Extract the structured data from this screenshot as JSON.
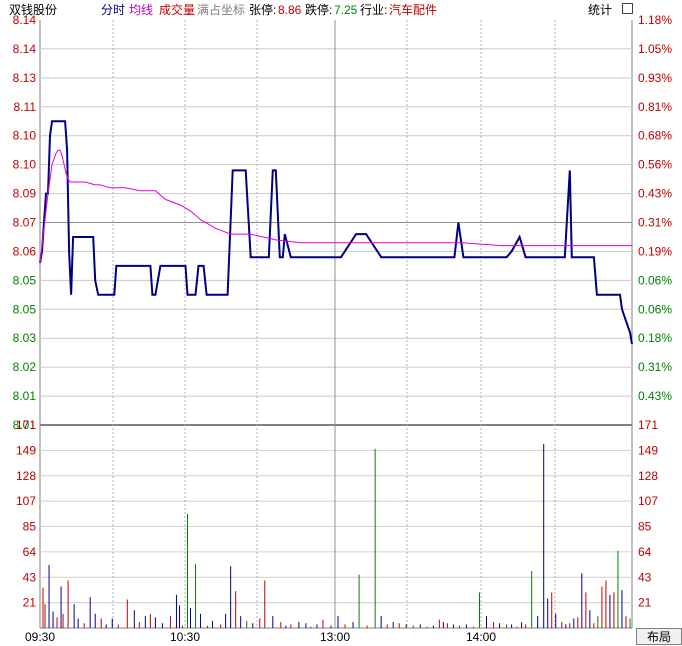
{
  "header": {
    "stock_name": "双钱股份",
    "tab_intraday": "分时",
    "tab_avg": "均线",
    "tab_volume": "成交量",
    "full_coord": "满占坐标",
    "limit_up_label": "张停:",
    "limit_up_value": "8.86",
    "limit_down_label": "跌停:",
    "limit_down_value": "7.25",
    "industry_label": "行业:",
    "industry_value": "汽车配件",
    "stats_label": "统计"
  },
  "layout_button": "布局",
  "colors": {
    "price_line": "#000080",
    "avg_line": "#e000e0",
    "up_text": "#c00000",
    "down_text": "#008000",
    "axis": "#808080",
    "blue": "#000080",
    "magenta": "#c000c0",
    "red": "#c00000"
  },
  "chart_data": [
    {
      "type": "line",
      "panel": "price",
      "y_labels_left": [
        "8.14",
        "8.14",
        "8.13",
        "8.11",
        "8.10",
        "8.10",
        "8.09",
        "8.07",
        "8.06",
        "8.05",
        "8.05",
        "8.03",
        "8.02",
        "8.01",
        "8.01"
      ],
      "y_labels_right": [
        "1.18%",
        "1.05%",
        "0.93%",
        "0.81%",
        "0.68%",
        "0.56%",
        "0.43%",
        "0.31%",
        "0.19%",
        "0.06%",
        "0.06%",
        "0.18%",
        "0.31%",
        "0.43%"
      ],
      "ylim": [
        8.0,
        8.14
      ],
      "x_ticks": [
        "09:30",
        "10:30",
        "13:00",
        "14:00"
      ],
      "series": [
        {
          "role": "price",
          "x": [
            0,
            2,
            4,
            6,
            8,
            10,
            12,
            14,
            17,
            21,
            25,
            27,
            29,
            31,
            33,
            35,
            37,
            40,
            53,
            55,
            58,
            60,
            68,
            74,
            76,
            80,
            90,
            100,
            105,
            110,
            112,
            115,
            120,
            127,
            129,
            132,
            136,
            145,
            147,
            155,
            158,
            160,
            163,
            166,
            168,
            171,
            183,
            187,
            192,
            196,
            199,
            205,
            210,
            215,
            228,
            232,
            235,
            239,
            242,
            244,
            250,
            262,
            275,
            290,
            295,
            300,
            315,
            318,
            320,
            325,
            340,
            348,
            352,
            356,
            360,
            367,
            380,
            385,
            390,
            395,
            402,
            413,
            417,
            422,
            428,
            436,
            445,
            447,
            457,
            465,
            470,
            478,
            484,
            488,
            492,
            496,
            498,
            502,
            506,
            512,
            517,
            523,
            528,
            530,
            532,
            535,
            538,
            541,
            545,
            549,
            552,
            555,
            558,
            560,
            565,
            568,
            572,
            575,
            578,
            580,
            585,
            588,
            590
          ],
          "y": [
            8.056,
            8.06,
            8.07,
            8.08,
            8.08,
            8.1,
            8.105,
            8.105,
            8.105,
            8.105,
            8.105,
            8.095,
            8.06,
            8.045,
            8.065,
            8.065,
            8.065,
            8.065,
            8.065,
            8.05,
            8.045,
            8.045,
            8.045,
            8.045,
            8.055,
            8.055,
            8.055,
            8.055,
            8.055,
            8.055,
            8.045,
            8.045,
            8.055,
            8.055,
            8.055,
            8.055,
            8.055,
            8.055,
            8.045,
            8.045,
            8.055,
            8.055,
            8.055,
            8.045,
            8.045,
            8.045,
            8.045,
            8.045,
            8.088,
            8.088,
            8.088,
            8.088,
            8.058,
            8.058,
            8.058,
            8.088,
            8.088,
            8.058,
            8.058,
            8.066,
            8.058,
            8.058,
            8.058,
            8.058,
            8.058,
            8.058,
            8.066,
            8.066,
            8.066,
            8.066,
            8.058,
            8.058,
            8.058,
            8.058,
            8.058,
            8.058,
            8.058,
            8.058,
            8.058,
            8.058,
            8.058,
            8.058,
            8.07,
            8.058,
            8.058,
            8.058,
            8.058,
            8.058,
            8.058,
            8.058,
            8.06,
            8.065,
            8.058,
            8.058,
            8.058,
            8.058,
            8.058,
            8.058,
            8.058,
            8.058,
            8.058,
            8.058,
            8.088,
            8.058,
            8.058,
            8.058,
            8.058,
            8.058,
            8.058,
            8.058,
            8.058,
            8.045,
            8.045,
            8.045,
            8.045,
            8.045,
            8.045,
            8.045,
            8.045,
            8.04,
            8.035,
            8.032,
            8.028
          ]
        },
        {
          "role": "average",
          "x": [
            0,
            4,
            8,
            12,
            16,
            18,
            20,
            22,
            24,
            26,
            28,
            30,
            35,
            45,
            55,
            60,
            70,
            85,
            100,
            115,
            125,
            140,
            150,
            160,
            175,
            190,
            210,
            235,
            260,
            290,
            330,
            380,
            420,
            460,
            500,
            540,
            570,
            590
          ],
          "y": [
            8.056,
            8.068,
            8.08,
            8.09,
            8.094,
            8.095,
            8.095,
            8.093,
            8.09,
            8.087,
            8.085,
            8.084,
            8.084,
            8.084,
            8.083,
            8.083,
            8.082,
            8.082,
            8.081,
            8.081,
            8.078,
            8.076,
            8.074,
            8.071,
            8.068,
            8.066,
            8.066,
            8.064,
            8.063,
            8.063,
            8.063,
            8.063,
            8.063,
            8.062,
            8.062,
            8.062,
            8.062,
            8.062
          ]
        }
      ]
    },
    {
      "type": "bar",
      "panel": "volume",
      "y_labels": [
        "171",
        "149",
        "128",
        "107",
        "85",
        "64",
        "43",
        "21"
      ],
      "ylim": [
        0,
        171
      ],
      "x": [
        3,
        5,
        9,
        13,
        17,
        21,
        23,
        28,
        34,
        38,
        44,
        50,
        55,
        61,
        66,
        72,
        78,
        87,
        94,
        99,
        105,
        110,
        115,
        122,
        130,
        136,
        139,
        142,
        147,
        150,
        155,
        160,
        167,
        172,
        180,
        185,
        190,
        195,
        200,
        206,
        212,
        219,
        224,
        232,
        240,
        245,
        250,
        258,
        265,
        270,
        276,
        282,
        290,
        297,
        304,
        312,
        318,
        326,
        334,
        340,
        346,
        352,
        358,
        365,
        372,
        379,
        386,
        392,
        398,
        402,
        406,
        412,
        418,
        425,
        432,
        438,
        445,
        452,
        458,
        465,
        470,
        475,
        480,
        484,
        490,
        496,
        502,
        506,
        510,
        514,
        520,
        524,
        528,
        532,
        536,
        540,
        544,
        548,
        552,
        556,
        560,
        564,
        568,
        572,
        576,
        580,
        584,
        588
      ],
      "values": [
        34,
        20,
        53,
        14,
        9,
        35,
        12,
        40,
        20,
        8,
        4,
        26,
        12,
        8,
        3,
        8,
        3,
        24,
        15,
        5,
        10,
        12,
        9,
        4,
        10,
        28,
        19,
        2,
        96,
        17,
        54,
        12,
        2,
        6,
        3,
        12,
        52,
        31,
        10,
        6,
        4,
        8,
        40,
        10,
        5,
        2,
        3,
        5,
        4,
        1,
        3,
        7,
        2,
        10,
        3,
        5,
        45,
        2,
        151,
        10,
        3,
        5,
        4,
        3,
        2,
        3,
        1,
        2,
        7,
        5,
        4,
        3,
        2,
        3,
        1,
        30,
        10,
        5,
        4,
        3,
        3,
        1,
        5,
        3,
        48,
        10,
        155,
        25,
        30,
        12,
        5,
        3,
        4,
        8,
        9,
        46,
        30,
        15,
        4,
        10,
        35,
        40,
        28,
        30,
        65,
        32,
        10,
        8
      ],
      "colors": [
        "red",
        "red",
        "blue",
        "blue",
        "red",
        "blue",
        "red",
        "red",
        "blue",
        "blue",
        "red",
        "blue",
        "blue",
        "red",
        "blue",
        "blue",
        "red",
        "red",
        "blue",
        "red",
        "blue",
        "red",
        "blue",
        "blue",
        "red",
        "blue",
        "blue",
        "red",
        "green",
        "blue",
        "green",
        "blue",
        "red",
        "blue",
        "red",
        "blue",
        "blue",
        "red",
        "blue",
        "green",
        "blue",
        "red",
        "red",
        "blue",
        "red",
        "blue",
        "red",
        "blue",
        "blue",
        "red",
        "blue",
        "red",
        "blue",
        "blue",
        "red",
        "blue",
        "green",
        "red",
        "green",
        "blue",
        "red",
        "blue",
        "red",
        "blue",
        "red",
        "blue",
        "red",
        "blue",
        "red",
        "blue",
        "red",
        "blue",
        "red",
        "blue",
        "red",
        "green",
        "blue",
        "red",
        "blue",
        "green",
        "blue",
        "red",
        "blue",
        "red",
        "green",
        "blue",
        "blue",
        "blue",
        "red",
        "blue",
        "red",
        "blue",
        "red",
        "blue",
        "red",
        "blue",
        "red",
        "blue",
        "red",
        "green",
        "red",
        "red",
        "blue",
        "red",
        "green",
        "blue",
        "red",
        "green"
      ]
    }
  ]
}
